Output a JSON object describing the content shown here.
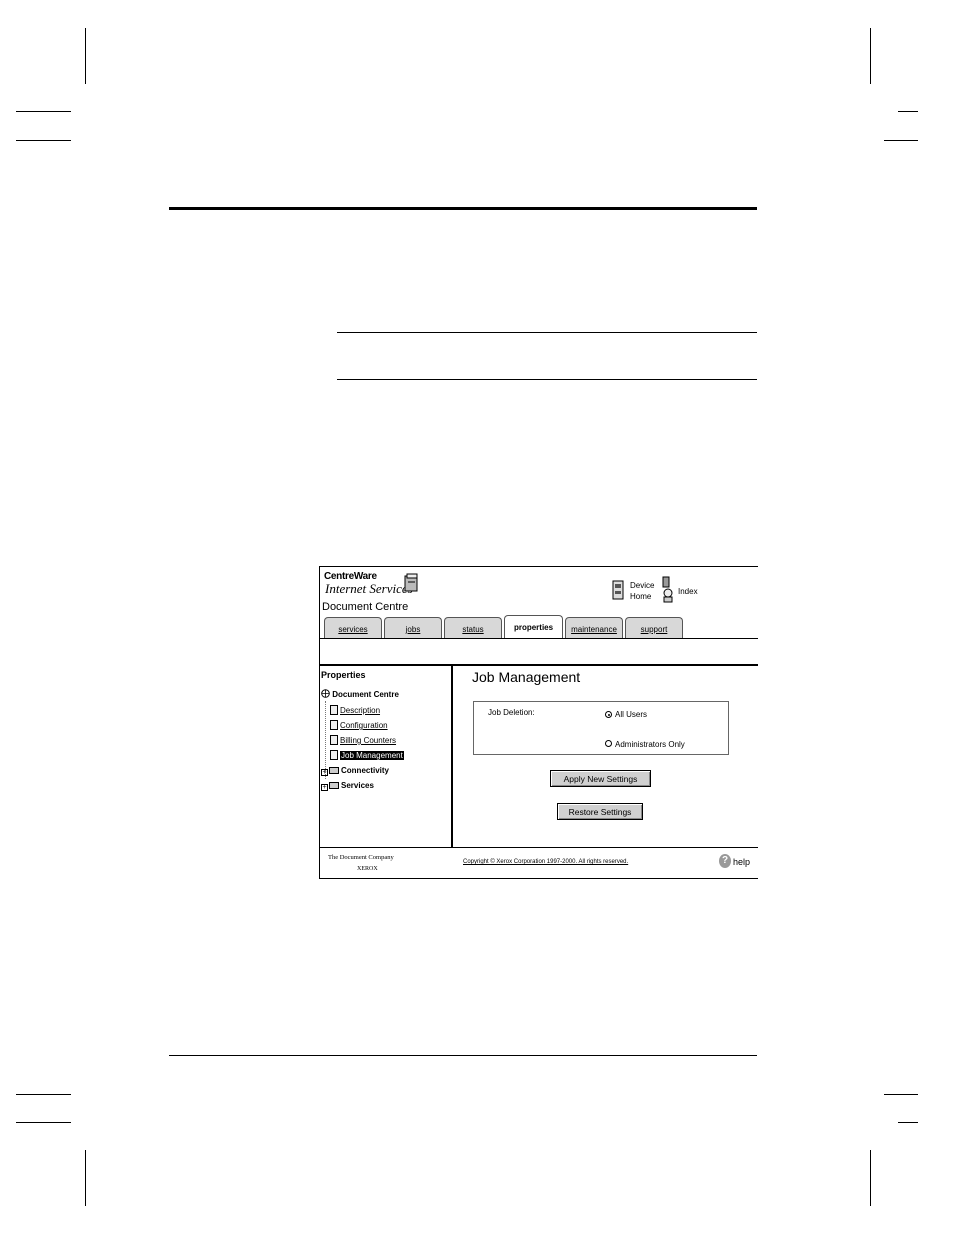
{
  "app": {
    "logo_line1": "CentreWare",
    "logo_line2": "Internet Services",
    "device_name": "Document Centre"
  },
  "header_links": {
    "device_home_line1": "Device",
    "device_home_line2": "Home",
    "index": "Index"
  },
  "tabs": [
    {
      "label": "services",
      "active": false
    },
    {
      "label": "jobs",
      "active": false
    },
    {
      "label": "status",
      "active": false
    },
    {
      "label": "properties",
      "active": true
    },
    {
      "label": "maintenance",
      "active": false
    },
    {
      "label": "support",
      "active": false
    }
  ],
  "nav": {
    "heading": "Properties",
    "root": "Document Centre",
    "items": [
      {
        "label": "Description"
      },
      {
        "label": "Configuration"
      },
      {
        "label": "Billing Counters"
      },
      {
        "label": "Job Management",
        "selected": true
      }
    ],
    "folders": [
      {
        "label": "Connectivity"
      },
      {
        "label": "Services"
      }
    ]
  },
  "content": {
    "title": "Job Management",
    "setting_label": "Job Deletion:",
    "options": [
      {
        "label": "All Users",
        "checked": true
      },
      {
        "label": "Administrators Only",
        "checked": false
      }
    ],
    "apply_button": "Apply New Settings",
    "restore_button": "Restore Settings"
  },
  "footer": {
    "company": "The Document Company",
    "brand": "XEROX",
    "copyright": "Copyright © Xerox Corporation 1997-2000. All rights reserved.",
    "help": "help"
  }
}
